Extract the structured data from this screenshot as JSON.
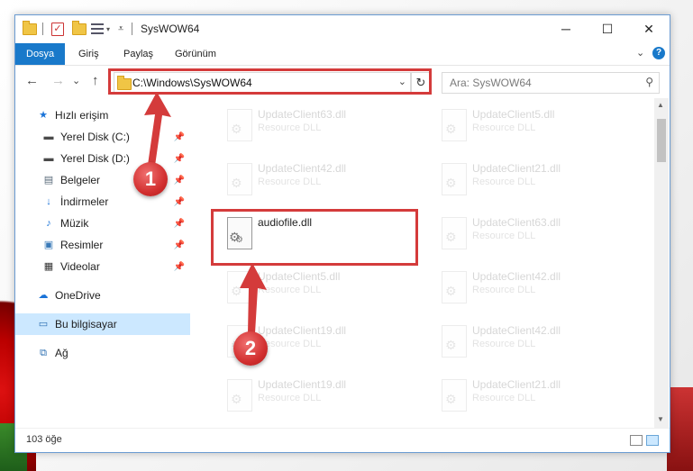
{
  "window": {
    "title": "SysWOW64",
    "controls": {
      "minimize": "─",
      "maximize": "☐",
      "close": "✕"
    }
  },
  "ribbon": {
    "tabs": [
      {
        "label": "Dosya",
        "active": true
      },
      {
        "label": "Giriş"
      },
      {
        "label": "Paylaş"
      },
      {
        "label": "Görünüm"
      }
    ],
    "expand_icon": "chevron-down-icon",
    "help_label": "?"
  },
  "navigation": {
    "back": "←",
    "forward": "→",
    "recent": "⌄",
    "up": "↑",
    "address": "C:\\Windows\\SysWOW64",
    "refresh": "↻",
    "search_placeholder": "Ara: SysWOW64"
  },
  "sidebar": {
    "quick_access": "Hızlı erişim",
    "items": [
      {
        "label": "Yerel Disk (C:)",
        "icon": "drive-icon",
        "pinned": true
      },
      {
        "label": "Yerel Disk (D:)",
        "icon": "drive-icon",
        "pinned": true
      },
      {
        "label": "Belgeler",
        "icon": "documents-icon",
        "pinned": true
      },
      {
        "label": "İndirmeler",
        "icon": "downloads-icon",
        "pinned": true
      },
      {
        "label": "Müzik",
        "icon": "music-icon",
        "pinned": true
      },
      {
        "label": "Resimler",
        "icon": "pictures-icon",
        "pinned": true
      },
      {
        "label": "Videolar",
        "icon": "videos-icon",
        "pinned": true
      }
    ],
    "onedrive": "OneDrive",
    "this_pc": "Bu bilgisayar",
    "network": "Ağ"
  },
  "files": {
    "left": [
      {
        "name": "UpdateClient63.dll",
        "type": "Resource DLL"
      },
      {
        "name": "UpdateClient42.dll",
        "type": "Resource DLL"
      },
      {
        "name": "audiofile.dll",
        "type": ""
      },
      {
        "name": "UpdateClient5.dll",
        "type": "Resource DLL"
      },
      {
        "name": "UpdateClient19.dll",
        "type": "Resource DLL"
      },
      {
        "name": "UpdateClient19.dll",
        "type": "Resource DLL"
      }
    ],
    "right": [
      {
        "name": "UpdateClient5.dll",
        "type": "Resource DLL"
      },
      {
        "name": "UpdateClient21.dll",
        "type": "Resource DLL"
      },
      {
        "name": "UpdateClient63.dll",
        "type": "Resource DLL"
      },
      {
        "name": "UpdateClient42.dll",
        "type": "Resource DLL"
      },
      {
        "name": "UpdateClient42.dll",
        "type": "Resource DLL"
      },
      {
        "name": "UpdateClient21.dll",
        "type": "Resource DLL"
      }
    ]
  },
  "status": {
    "item_count": "103 öğe"
  },
  "annotations": {
    "step1": "1",
    "step2": "2",
    "color": "#d43b3b"
  }
}
